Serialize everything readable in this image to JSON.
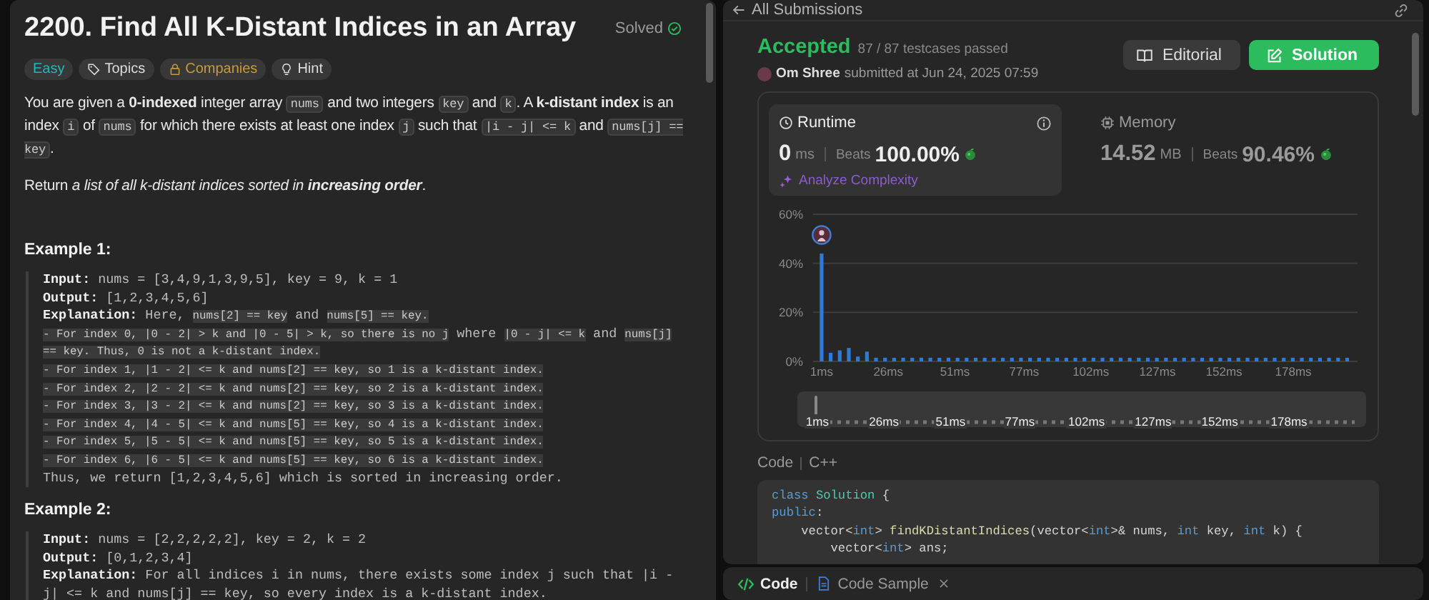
{
  "problem": {
    "title": "2200. Find All K-Distant Indices in an Array",
    "status": "Solved",
    "tags": [
      {
        "kind": "difficulty",
        "label": "Easy"
      },
      {
        "kind": "topics",
        "label": "Topics"
      },
      {
        "kind": "companies",
        "label": "Companies"
      },
      {
        "kind": "hint",
        "label": "Hint"
      }
    ],
    "paragraphs": [
      [
        {
          "kind": "text",
          "text": "You are given a **0-indexed** integer array "
        },
        {
          "kind": "code",
          "text": "nums"
        },
        {
          "kind": "text",
          "text": " and two integers "
        },
        {
          "kind": "code",
          "text": "key"
        },
        {
          "kind": "text",
          "text": " and "
        },
        {
          "kind": "code",
          "text": "k"
        },
        {
          "kind": "text",
          "text": ". A **k-distant index** is an index "
        },
        {
          "kind": "code",
          "text": "i"
        },
        {
          "kind": "text",
          "text": " of "
        },
        {
          "kind": "code",
          "text": "nums"
        },
        {
          "kind": "text",
          "text": " for which there exists at least one index "
        },
        {
          "kind": "code",
          "text": "j"
        },
        {
          "kind": "text",
          "text": " such that "
        },
        {
          "kind": "code",
          "text": "|i - j| <= k"
        },
        {
          "kind": "text",
          "text": " and "
        },
        {
          "kind": "code",
          "text": "nums[j] == key"
        },
        {
          "kind": "text",
          "text": "."
        }
      ],
      [
        {
          "kind": "text",
          "text": "Return "
        },
        {
          "kind": "em",
          "text": "a list of all k-distant indices sorted in **increasing order**"
        },
        {
          "kind": "text",
          "text": "."
        }
      ]
    ],
    "examples": [
      {
        "heading": "Example 1:",
        "lines": [
          [
            {
              "kind": "label",
              "text": "Input:"
            },
            {
              "kind": "text",
              "text": " nums = [3,4,9,1,3,9,5], key = 9, k = 1"
            }
          ],
          [
            {
              "kind": "label",
              "text": "Output:"
            },
            {
              "kind": "text",
              "text": " [1,2,3,4,5,6]"
            }
          ],
          [
            {
              "kind": "label",
              "text": "Explanation:"
            },
            {
              "kind": "text",
              "text": " Here, "
            },
            {
              "kind": "code",
              "text": "nums[2] == key"
            },
            {
              "kind": "text",
              "text": " and "
            },
            {
              "kind": "code",
              "text": "nums[5] == key."
            }
          ],
          [
            {
              "kind": "code",
              "text": "- For index 0, |0 - 2| > k and |0 - 5| > k, so there is no j"
            },
            {
              "kind": "text",
              "text": " where "
            },
            {
              "kind": "code",
              "text": "|0 - j| <= k"
            },
            {
              "kind": "text",
              "text": " and "
            },
            {
              "kind": "code",
              "text": "nums[j]"
            }
          ],
          [
            {
              "kind": "code",
              "text": "== key. Thus, 0 is not a k-distant index."
            }
          ],
          [
            {
              "kind": "code",
              "text": "- For index 1, |1 - 2| <= k and nums[2] == key, so 1 is a k-distant index."
            }
          ],
          [
            {
              "kind": "code",
              "text": "- For index 2, |2 - 2| <= k and nums[2] == key, so 2 is a k-distant index."
            }
          ],
          [
            {
              "kind": "code",
              "text": "- For index 3, |3 - 2| <= k and nums[2] == key, so 3 is a k-distant index."
            }
          ],
          [
            {
              "kind": "code",
              "text": "- For index 4, |4 - 5| <= k and nums[5] == key, so 4 is a k-distant index."
            }
          ],
          [
            {
              "kind": "code",
              "text": "- For index 5, |5 - 5| <= k and nums[5] == key, so 5 is a k-distant index."
            }
          ],
          [
            {
              "kind": "code",
              "text": "- For index 6, |6 - 5| <= k and nums[5] == key, so 6 is a k-distant index."
            }
          ],
          [
            {
              "kind": "text",
              "text": "Thus, we return [1,2,3,4,5,6] which is sorted in increasing order."
            }
          ]
        ]
      },
      {
        "heading": "Example 2:",
        "lines": [
          [
            {
              "kind": "label",
              "text": "Input:"
            },
            {
              "kind": "text",
              "text": " nums = [2,2,2,2,2], key = 2, k = 2"
            }
          ],
          [
            {
              "kind": "label",
              "text": "Output:"
            },
            {
              "kind": "text",
              "text": " [0,1,2,3,4]"
            }
          ],
          [
            {
              "kind": "label",
              "text": "Explanation:"
            },
            {
              "kind": "text",
              "text": " For all indices i in nums, there exists some index j such that |i -"
            }
          ],
          [
            {
              "kind": "text",
              "text": "j| <= k and nums[j] == key, so every index is a k-distant index."
            }
          ]
        ]
      }
    ]
  },
  "submission": {
    "back_label": "All Submissions",
    "status": "Accepted",
    "testcases": "87 / 87 testcases passed",
    "user": "Om Shree",
    "submitted": "submitted at Jun 24, 2025 07:59",
    "buttons": [
      {
        "kind": "editorial",
        "label": "Editorial"
      },
      {
        "kind": "solution",
        "label": "Solution"
      }
    ],
    "metrics": [
      {
        "kind": "runtime",
        "label": "Runtime",
        "value": "0",
        "unit": "ms",
        "beats_label": "Beats",
        "beats": "100.00%",
        "selected": true,
        "action": "Analyze Complexity"
      },
      {
        "kind": "memory",
        "label": "Memory",
        "value": "14.52",
        "unit": "MB",
        "beats_label": "Beats",
        "beats": "90.46%",
        "selected": false
      }
    ],
    "chart_data": {
      "type": "bar",
      "x": [
        1,
        4.4,
        7.8,
        11.2,
        14.6,
        18,
        21.4,
        24.8,
        28.2,
        31.6,
        35,
        38.4,
        41.8,
        45.2,
        48.6,
        52,
        55.4,
        58.8,
        62.2,
        65.6,
        69,
        72.4,
        75.8,
        79.2,
        82.6,
        86,
        89.4,
        92.8,
        96.2,
        99.6,
        103,
        106.4,
        109.8,
        113.2,
        116.6,
        120,
        123.4,
        126.8,
        130.2,
        133.6,
        137,
        140.4,
        143.8,
        147.2,
        150.6,
        154,
        157.4,
        160.8,
        164.2,
        167.6,
        171,
        174.4,
        177.8,
        181.2,
        184.6,
        188,
        191.4,
        194.8,
        198.2
      ],
      "series": [
        {
          "color": "#2f7ad9",
          "values": [
            44,
            3.5,
            4.5,
            5.5,
            2,
            4,
            1.5,
            1.5,
            1.5,
            1.5,
            1.5,
            1.5,
            1.5,
            1.5,
            1.5,
            1.5,
            1.5,
            1.5,
            1.5,
            1.5,
            1.5,
            1.5,
            1.5,
            1.5,
            1.5,
            1.5,
            1.5,
            1.5,
            1.5,
            1.5,
            1.5,
            1.5,
            1.5,
            1.5,
            1.5,
            1.5,
            1.5,
            1.5,
            1.5,
            1.5,
            1.5,
            1.5,
            1.5,
            1.5,
            1.5,
            1.5,
            1.5,
            1.5,
            1.5,
            1.5,
            1.5,
            1.5,
            1.5,
            1.5,
            1.5,
            1.5,
            1.5,
            1.5,
            1.5
          ]
        }
      ],
      "xlim": [
        -2.2,
        202.1
      ],
      "ylim": [
        0,
        60
      ],
      "xticks": [
        {
          "value": 1,
          "label": "1ms"
        },
        {
          "value": 26,
          "label": "26ms"
        },
        {
          "value": 51,
          "label": "51ms"
        },
        {
          "value": 77,
          "label": "77ms"
        },
        {
          "value": 102,
          "label": "102ms"
        },
        {
          "value": 127,
          "label": "127ms"
        },
        {
          "value": 152,
          "label": "152ms"
        },
        {
          "value": 178,
          "label": "178ms"
        }
      ],
      "yticks": [
        {
          "value": 0,
          "label": "0%"
        },
        {
          "value": 20,
          "label": "20%"
        },
        {
          "value": 40,
          "label": "40%"
        },
        {
          "value": 60,
          "label": "60%"
        }
      ],
      "orientation": "vertical"
    },
    "range_slider": {
      "level": 0,
      "labels": [
        "1ms",
        "26ms",
        "51ms",
        "77ms",
        "102ms",
        "127ms",
        "152ms",
        "178ms"
      ]
    },
    "code_label": "Code",
    "language": "C++",
    "code": [
      [
        {
          "kind": "keyword",
          "text": "class"
        },
        {
          "kind": "type",
          "text": " Solution"
        },
        {
          "kind": "plain",
          "text": " {"
        }
      ],
      [
        {
          "kind": "keyword",
          "text": "public"
        },
        {
          "kind": "plain",
          "text": ":"
        }
      ],
      [
        {
          "kind": "plain",
          "text": "    vector<"
        },
        {
          "kind": "keyword",
          "text": "int"
        },
        {
          "kind": "plain",
          "text": "> "
        },
        {
          "kind": "func",
          "text": "findKDistantIndices"
        },
        {
          "kind": "plain",
          "text": "(vector<"
        },
        {
          "kind": "keyword",
          "text": "int"
        },
        {
          "kind": "plain",
          "text": ">& nums, "
        },
        {
          "kind": "keyword",
          "text": "int"
        },
        {
          "kind": "plain",
          "text": " key, "
        },
        {
          "kind": "keyword",
          "text": "int"
        },
        {
          "kind": "plain",
          "text": " k) {"
        }
      ],
      [
        {
          "kind": "plain",
          "text": "        vector<"
        },
        {
          "kind": "keyword",
          "text": "int"
        },
        {
          "kind": "plain",
          "text": "> ans;"
        }
      ]
    ]
  },
  "bottom_tabs": [
    {
      "kind": "code",
      "label": "Code",
      "selected": true,
      "closable": false
    },
    {
      "kind": "file",
      "label": "Code Sample",
      "selected": false,
      "closable": true
    }
  ]
}
